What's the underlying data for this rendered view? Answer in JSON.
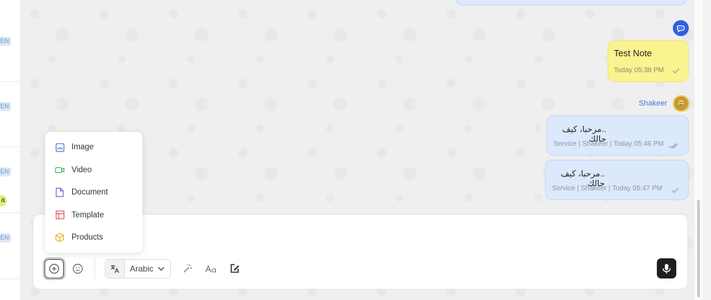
{
  "left_list": {
    "badges": [
      "EN",
      "EN",
      "EN",
      "EN"
    ],
    "avatar_initial": "a"
  },
  "messages": {
    "note": {
      "title": "Test Note",
      "time": "Today 05:38 PM"
    },
    "sender": {
      "name": "Shakeer"
    },
    "items": [
      {
        "text": "..مرحبا، كيف حالك",
        "meta": "Service | Shakeer | Today 05:46 PM",
        "status": "read"
      },
      {
        "text": "..مرحبا، كيف حالك",
        "meta": "Service | Shakeer | Today 05:47 PM",
        "status": "sent"
      }
    ]
  },
  "attach_menu": {
    "items": [
      {
        "label": "Image",
        "icon": "image-icon",
        "color": "#3b6fd6"
      },
      {
        "label": "Video",
        "icon": "video-icon",
        "color": "#2fae5a"
      },
      {
        "label": "Document",
        "icon": "document-icon",
        "color": "#8a5ad8"
      },
      {
        "label": "Template",
        "icon": "template-icon",
        "color": "#e04b4b"
      },
      {
        "label": "Products",
        "icon": "products-icon",
        "color": "#e9b21a"
      }
    ]
  },
  "composer": {
    "language": "Arabic",
    "tools": [
      "add-icon",
      "emoji-icon",
      "translate-icon",
      "magic-wand-icon",
      "text-format-icon",
      "signature-edit-icon",
      "microphone-icon"
    ]
  },
  "colors": {
    "primary": "#2f5fe0",
    "note_bg": "#fbf390",
    "message_bg": "#dce8fb",
    "sender_name": "#4a78d8"
  }
}
